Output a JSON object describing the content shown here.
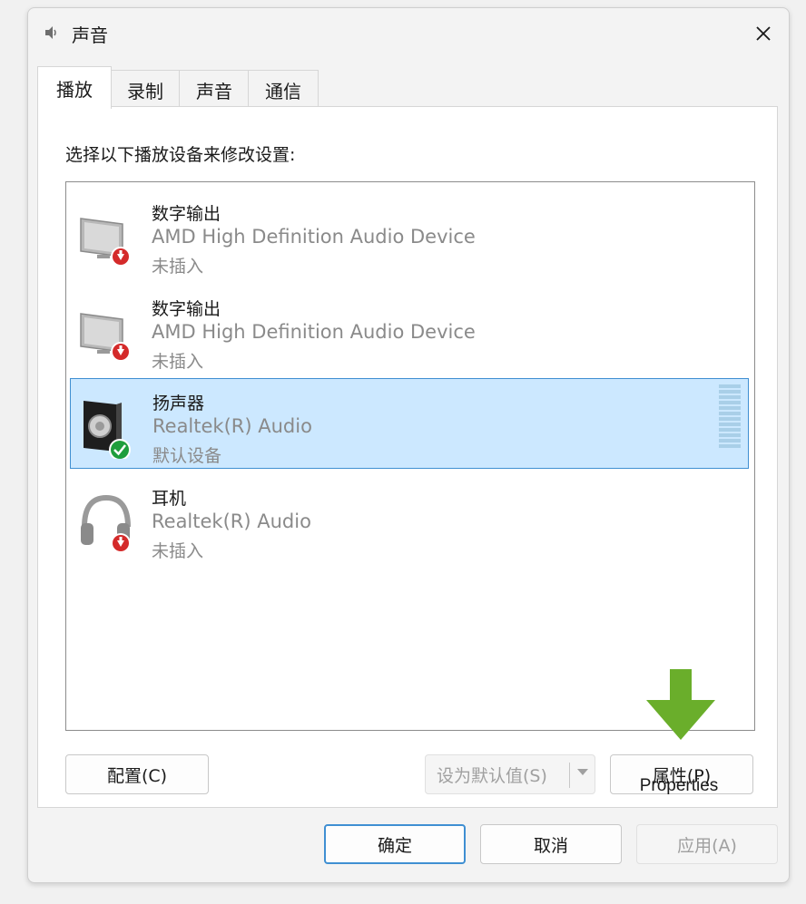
{
  "window": {
    "title": "声音"
  },
  "tabs": [
    {
      "label": "播放",
      "active": true
    },
    {
      "label": "录制",
      "active": false
    },
    {
      "label": "声音",
      "active": false
    },
    {
      "label": "通信",
      "active": false
    }
  ],
  "panel": {
    "instruction": "选择以下播放设备来修改设置:"
  },
  "devices": [
    {
      "name": "数字输出",
      "description": "AMD High Definition Audio Device",
      "status": "未插入",
      "icon": "monitor-icon",
      "badge": "unplugged"
    },
    {
      "name": "数字输出",
      "description": "AMD High Definition Audio Device",
      "status": "未插入",
      "icon": "monitor-icon",
      "badge": "unplugged"
    },
    {
      "name": "扬声器",
      "description": "Realtek(R) Audio",
      "status": "默认设备",
      "icon": "speaker-icon",
      "badge": "default",
      "selected": true
    },
    {
      "name": "耳机",
      "description": "Realtek(R) Audio",
      "status": "未插入",
      "icon": "headphones-icon",
      "badge": "unplugged"
    }
  ],
  "buttons": {
    "configure": "配置(C)",
    "set_default": "设为默认值(S)",
    "properties": "属性(P)",
    "ok": "确定",
    "cancel": "取消",
    "apply": "应用(A)"
  },
  "annotation": {
    "label": "Properties",
    "arrow_color": "#6aae2b"
  },
  "colors": {
    "selection": "#cce8ff",
    "selection_border": "#3f8fd2",
    "badge_red": "#d42a2a",
    "badge_green": "#1e9e3c"
  }
}
